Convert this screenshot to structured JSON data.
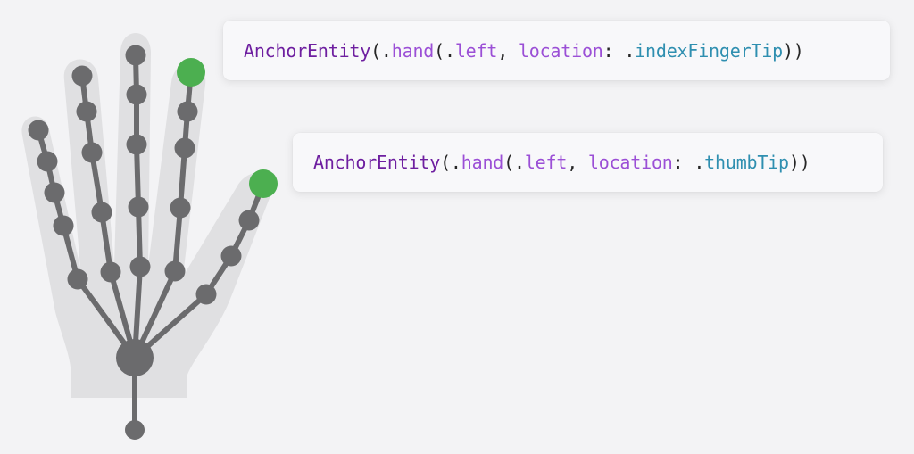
{
  "colors": {
    "background": "#f3f3f5",
    "hand_silhouette": "#e0e0e2",
    "joint": "#6b6b6d",
    "highlight_joint": "#4caf50",
    "code_type": "#6e1fa0",
    "code_member": "#9b4fd6",
    "code_property": "#2f8fb0",
    "code_punctuation": "#262626"
  },
  "cards": [
    {
      "tokens": [
        {
          "text": "AnchorEntity",
          "role": "type"
        },
        {
          "text": "(.",
          "role": "punct"
        },
        {
          "text": "hand",
          "role": "member"
        },
        {
          "text": "(.",
          "role": "punct"
        },
        {
          "text": "left",
          "role": "member"
        },
        {
          "text": ", ",
          "role": "punct"
        },
        {
          "text": "location",
          "role": "member"
        },
        {
          "text": ": .",
          "role": "punct"
        },
        {
          "text": "indexFingerTip",
          "role": "property"
        },
        {
          "text": "))",
          "role": "punct"
        }
      ]
    },
    {
      "tokens": [
        {
          "text": "AnchorEntity",
          "role": "type"
        },
        {
          "text": "(.",
          "role": "punct"
        },
        {
          "text": "hand",
          "role": "member"
        },
        {
          "text": "(.",
          "role": "punct"
        },
        {
          "text": "left",
          "role": "member"
        },
        {
          "text": ", ",
          "role": "punct"
        },
        {
          "text": "location",
          "role": "member"
        },
        {
          "text": ": .",
          "role": "punct"
        },
        {
          "text": "thumbTip",
          "role": "property"
        },
        {
          "text": "))",
          "role": "punct"
        }
      ]
    }
  ],
  "highlighted_joints": [
    "indexFingerTip",
    "thumbTip"
  ]
}
